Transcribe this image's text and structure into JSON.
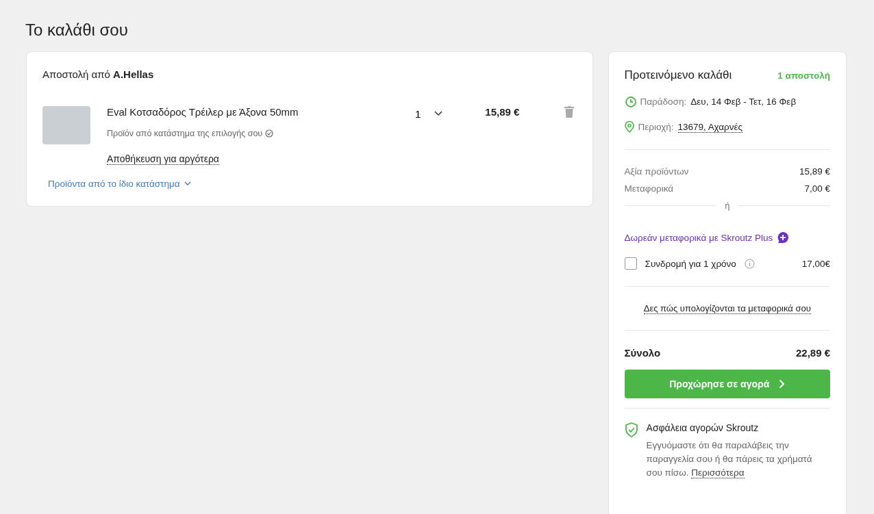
{
  "title": "Το καλάθι σου",
  "shipment": {
    "label": "Αποστολή από",
    "shop": "A.Hellas",
    "items": [
      {
        "name": "Eval Κοτσαδόρος Τρέιλερ με Άξονα 50mm",
        "quantity": "1",
        "price": "15,89 €",
        "note": "Προϊόν από κατάστημα της επιλογής σου",
        "save_link": "Αποθήκευση για αργότερα"
      }
    ],
    "more_link": "Προϊόντα από το ίδιο κατάστημα"
  },
  "summary": {
    "title": "Προτεινόμενο καλάθι",
    "shipments": "1 αποστολή",
    "delivery_label": "Παράδοση:",
    "delivery": "Δευ, 14 Φεβ - Τετ, 16 Φεβ",
    "area_label": "Περιοχή:",
    "area": "13679, Αχαρνές",
    "lines": [
      {
        "label": "Αξία προϊόντων",
        "value": "15,89 €"
      },
      {
        "label": "Μεταφορικά",
        "value": "7,00 €"
      }
    ],
    "or": "ή",
    "plus_link": "Δωρεάν μεταφορικά με Skroutz Plus",
    "subscription": {
      "label": "Συνδρομή για 1 χρόνο",
      "checked": false,
      "price": "17,00€"
    },
    "shipping_link": "Δες πώς υπολογίζονται τα μεταφορικά σου",
    "total_label": "Σύνολο",
    "total": "22,89 €",
    "checkout": "Προχώρησε σε αγορά",
    "guarantee": {
      "title": "Ασφάλεια αγορών Skroutz",
      "text": "Εγγυόμαστε ότι θα παραλάβεις την παραγγελία σου ή θα πάρεις τα χρήματά σου πίσω.",
      "link": "Περισσότερα"
    }
  }
}
